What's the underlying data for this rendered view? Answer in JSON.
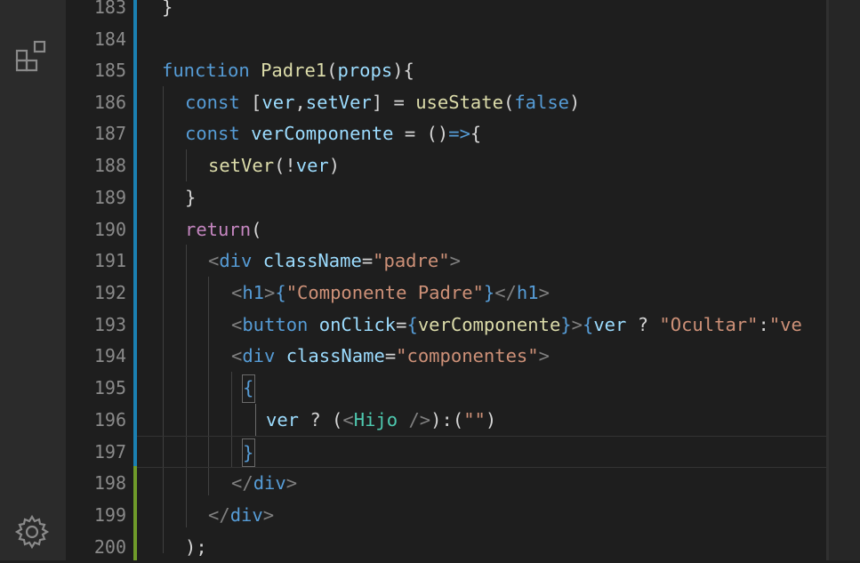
{
  "activity_bar": {
    "icons": [
      "extensions-icon",
      "settings-gear-icon"
    ]
  },
  "line_numbers": [
    "183",
    "184",
    "185",
    "186",
    "187",
    "188",
    "189",
    "190",
    "191",
    "192",
    "193",
    "194",
    "195",
    "196",
    "197",
    "198",
    "199",
    "200"
  ],
  "code": {
    "l183_close": "}",
    "l185_function": "function",
    "l185_name": "Padre1",
    "l185_open": "(",
    "l185_param": "props",
    "l185_close": "){",
    "l186_const": "const",
    "l186_open": " [",
    "l186_ver": "ver",
    "l186_comma": ",",
    "l186_setver": "setVer",
    "l186_eq": "] = ",
    "l186_usestate": "useState",
    "l186_paren": "(",
    "l186_false": "false",
    "l186_end": ")",
    "l187_const": "const",
    "l187_name": "verComponente",
    "l187_eq": " = ",
    "l187_parens": "()",
    "l187_arrow": "=>",
    "l187_brace": "{",
    "l188_fn": "setVer",
    "l188_open": "(!",
    "l188_var": "ver",
    "l188_close": ")",
    "l189_close": "}",
    "l190_return": "return",
    "l190_paren": "(",
    "l191_lt": "<",
    "l191_tag": "div",
    "l191_attr": "className",
    "l191_eq": "=",
    "l191_val": "\"padre\"",
    "l191_gt": ">",
    "l192_lt": "<",
    "l192_tag": "h1",
    "l192_gt": ">",
    "l192_open": "{",
    "l192_str": "\"Componente Padre\"",
    "l192_close": "}",
    "l192_lt2": "</",
    "l192_tag2": "h1",
    "l192_gt2": ">",
    "l193_lt": "<",
    "l193_tag": "button",
    "l193_attr": "onClick",
    "l193_eq": "=",
    "l193_open": "{",
    "l193_fn": "verComponente",
    "l193_close": "}",
    "l193_gt": ">",
    "l193_open2": "{",
    "l193_var": "ver",
    "l193_q": " ? ",
    "l193_str1": "\"Ocultar\"",
    "l193_colon": ":",
    "l193_str2": "\"ve",
    "l194_lt": "<",
    "l194_tag": "div",
    "l194_attr": "className",
    "l194_eq": "=",
    "l194_val": "\"componentes\"",
    "l194_gt": ">",
    "l195_brace": "{",
    "l196_var": "ver",
    "l196_q": " ? (",
    "l196_lt": "<",
    "l196_tag": "Hijo",
    "l196_selfclose": " />",
    "l196_rest": "):(",
    "l196_str": "\"\"",
    "l196_end": ")",
    "l197_brace": "}",
    "l198_lt": "</",
    "l198_tag": "div",
    "l198_gt": ">",
    "l199_lt": "</",
    "l199_tag": "div",
    "l199_gt": ">",
    "l200_end": ");"
  }
}
